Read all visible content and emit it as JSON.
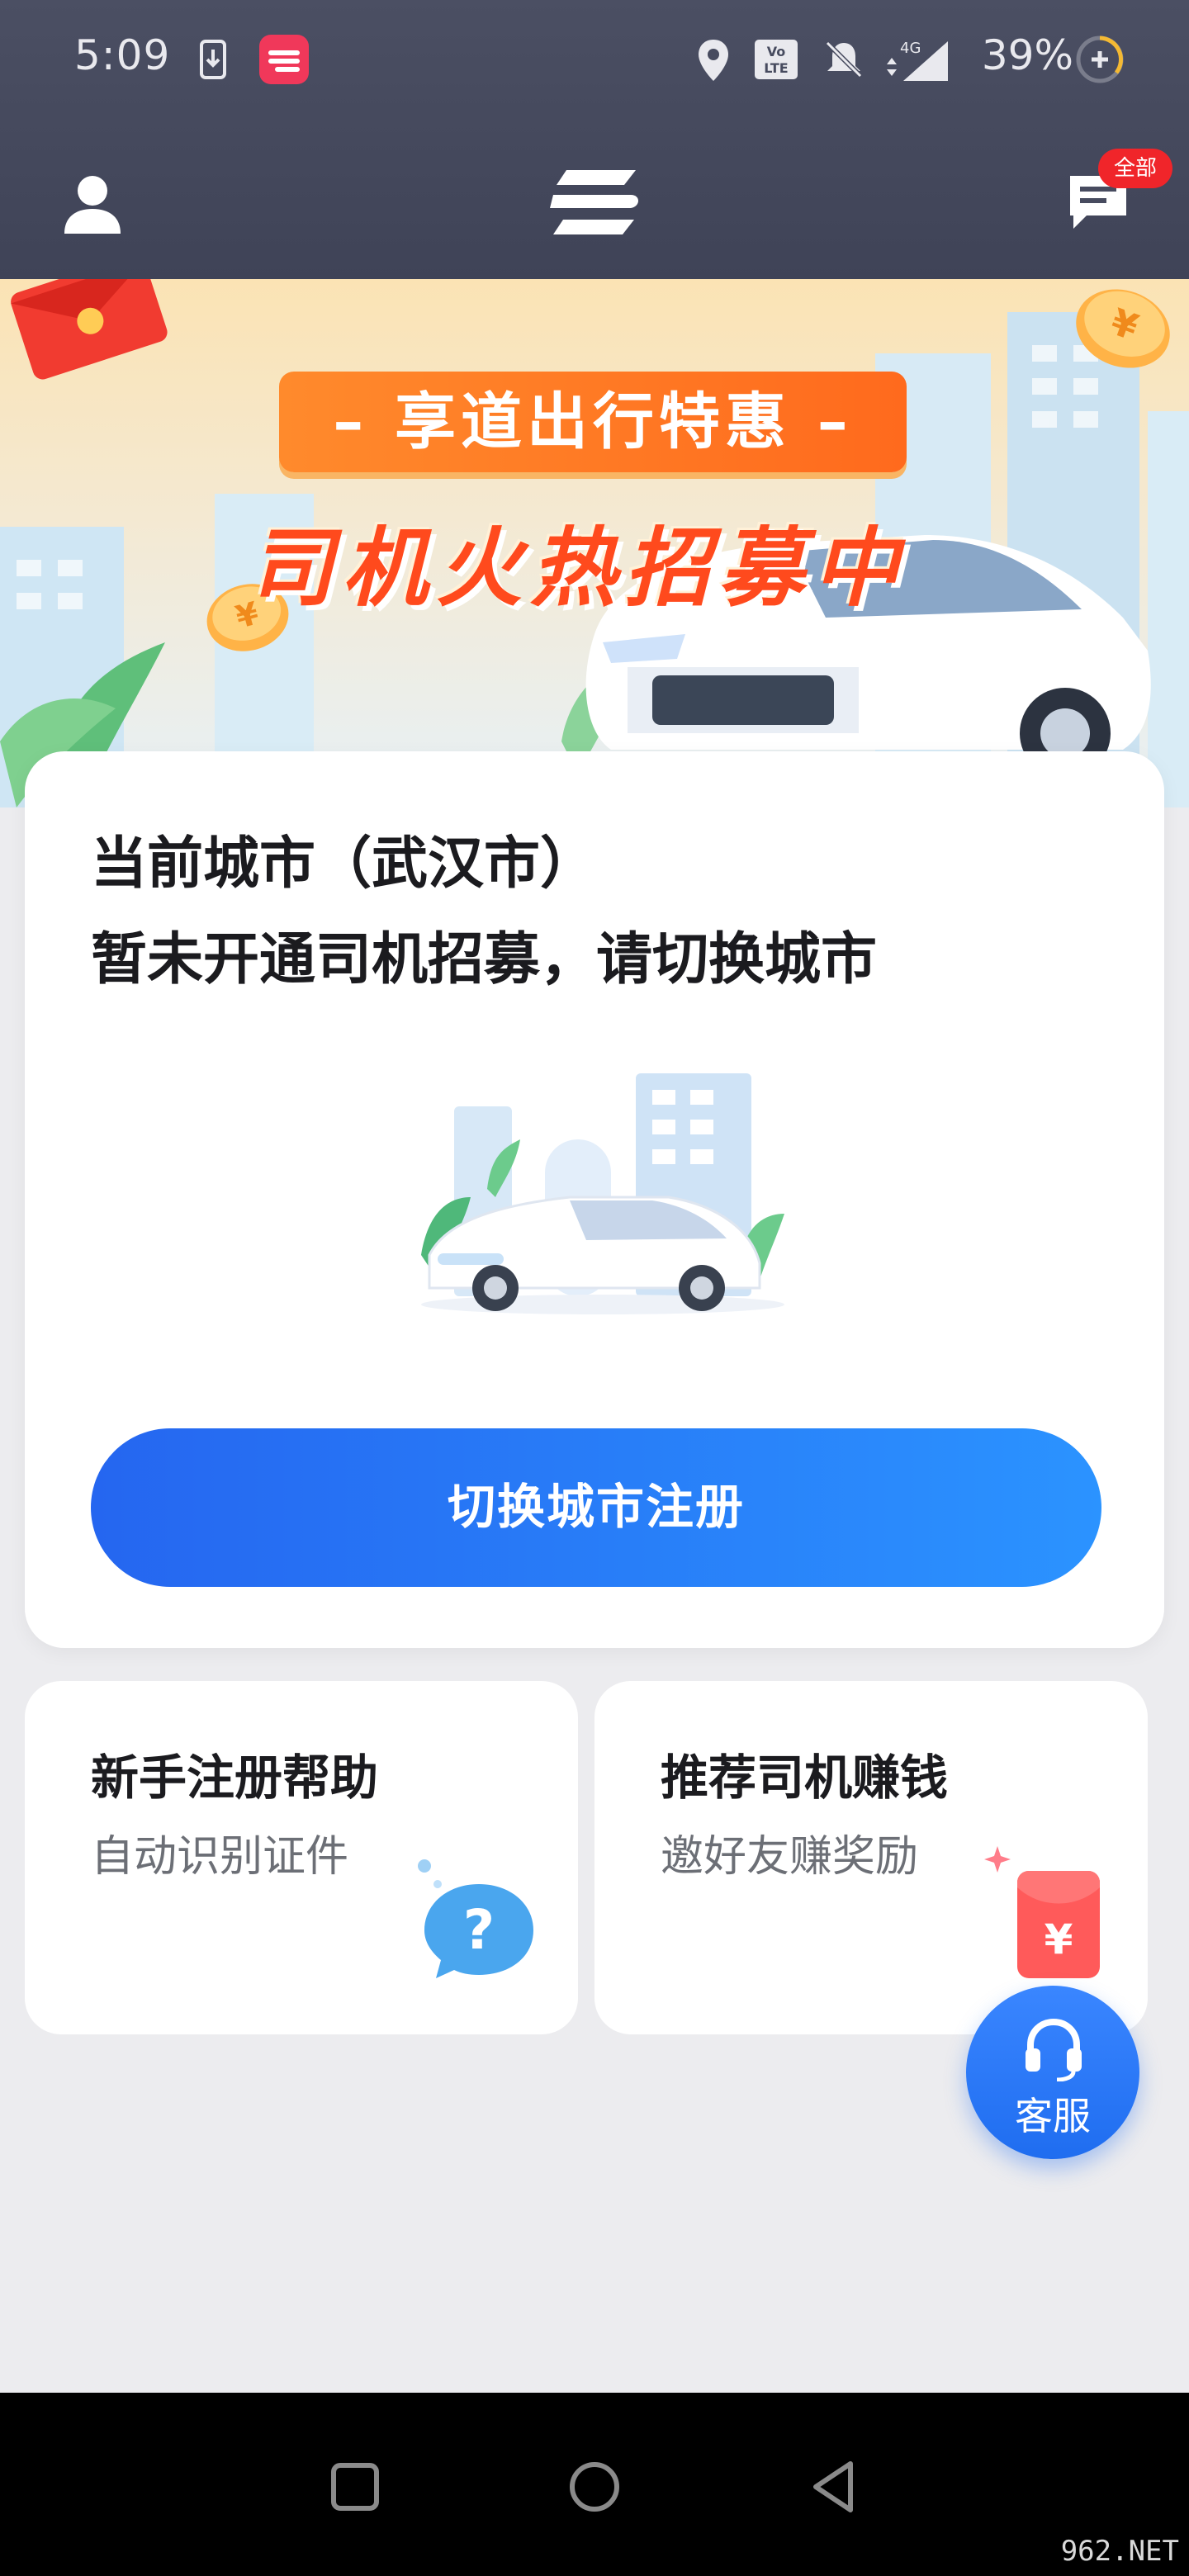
{
  "status_bar": {
    "time": "5:09",
    "battery": "39%",
    "network": "4G"
  },
  "app_bar": {
    "badge": "全部"
  },
  "banner": {
    "promo": "– 享道出行特惠 –",
    "headline": "司机火热招募中"
  },
  "main_card": {
    "city_line": "当前城市（武汉市）",
    "notice": "暂未开通司机招募，请切换城市",
    "button": "切换城市注册"
  },
  "cards": [
    {
      "title": "新手注册帮助",
      "subtitle": "自动识别证件"
    },
    {
      "title": "推荐司机赚钱",
      "subtitle": "邀好友赚奖励"
    }
  ],
  "service_button": {
    "label": "客服"
  },
  "colors": {
    "primary": "#2b7bff",
    "header_bg": "#474b5f",
    "promo_orange": "#ff6a1d",
    "badge_red": "#f0252a"
  },
  "watermark": "962.NET"
}
